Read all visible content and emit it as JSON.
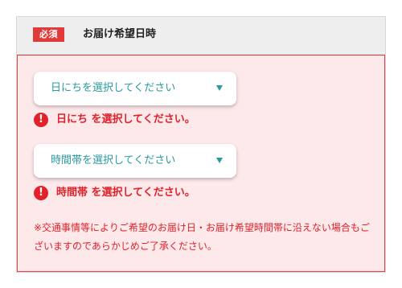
{
  "header": {
    "required_badge": "必須",
    "title": "お届け希望日時"
  },
  "date_select": {
    "label": "日にちを選択してください",
    "error": "日にち を選択してください。"
  },
  "time_select": {
    "label": "時間帯を選択してください",
    "error": "時間帯 を選択してください。"
  },
  "error_icon_glyph": "!",
  "note": "※交通事情等によりご希望のお届け日・お届け希望時間帯に沿えない場合もございますのであらかじめご了承ください。",
  "colors": {
    "required_badge": "#e03a3a",
    "error": "#e0222b",
    "select_text": "#2a9aa0",
    "panel_background": "#fde8ea"
  }
}
